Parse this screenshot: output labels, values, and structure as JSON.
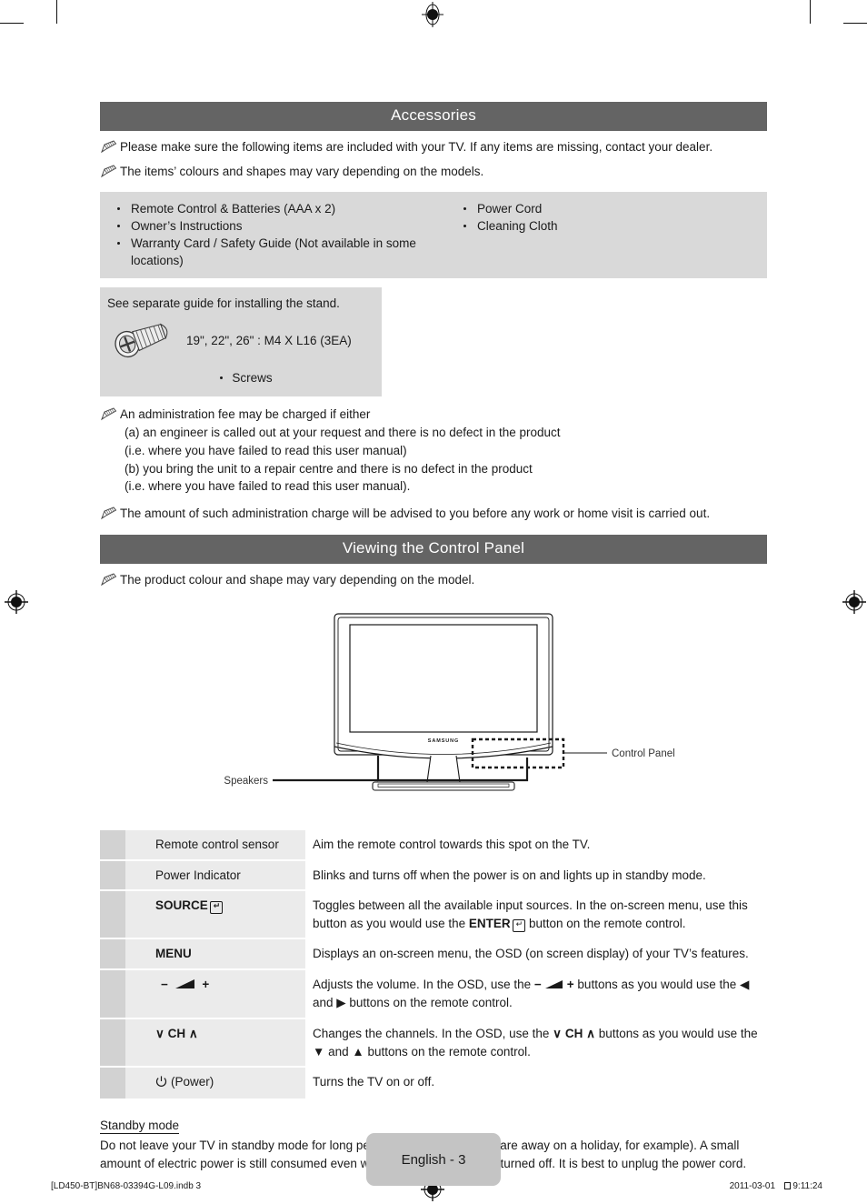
{
  "document": {
    "page_label": "English - 3",
    "footer_file": "[LD450-BT]BN68-03394G-L09.indb   3",
    "footer_page_num": "3",
    "footer_date": "2011-03-01",
    "footer_time": "9:11:24"
  },
  "accessories": {
    "heading": "Accessories",
    "notes": [
      "Please make sure the following items are included with your TV. If any items are missing, contact your dealer.",
      "The items’ colours and shapes may vary depending on the models."
    ],
    "items_left": [
      "Remote Control & Batteries (AAA x 2)",
      "Owner’s Instructions",
      "Warranty Card / Safety Guide (Not available in some locations)"
    ],
    "items_right": [
      "Power Cord",
      "Cleaning Cloth"
    ],
    "stand": {
      "title": "See separate guide for installing the stand.",
      "screw_spec": "19\", 22\", 26\" : M4 X L16 (3EA)",
      "screw_label": "Screws"
    },
    "admin_note_intro": "An administration fee may be charged if either",
    "admin_note_lines": [
      "(a) an engineer is called out at your request and there is no defect in the product",
      "(i.e. where you have failed to read this user manual)",
      "(b) you bring the unit to a repair centre and there is no defect in the product",
      "(i.e. where you have failed to read this user manual)."
    ],
    "admin_note_outro": "The amount of such administration charge will be advised to you before any work or home visit is carried out."
  },
  "control_panel": {
    "heading": "Viewing the Control Panel",
    "note": "The product colour and shape may vary depending on the model.",
    "figure": {
      "brand": "SAMSUNG",
      "callout_control_panel": "Control Panel",
      "callout_speakers": "Speakers"
    },
    "rows": [
      {
        "label": "Remote control sensor",
        "bold": false,
        "desc": "Aim the remote control towards this spot on the TV."
      },
      {
        "label": "Power Indicator",
        "bold": false,
        "desc": "Blinks and turns off when the power is on and lights up in standby mode."
      },
      {
        "label": "SOURCE",
        "bold": true,
        "has_enter_key": true,
        "desc_pre": "Toggles between all the available input sources. In the on-screen menu, use this button as you would use the ",
        "desc_mid": "ENTER",
        "desc_post": " button on the remote control."
      },
      {
        "label": "MENU",
        "bold": true,
        "desc": "Displays an on-screen menu, the OSD (on screen display) of your TV’s features."
      },
      {
        "label": "VOLUME",
        "bold": true,
        "is_volume": true,
        "desc_pre": "Adjusts the volume. In the OSD, use the ",
        "desc_post": " buttons as you would use the ◀ and ▶ buttons on the remote control."
      },
      {
        "label": "CH",
        "bold": true,
        "is_channel": true,
        "desc_pre": "Changes the channels. In the OSD, use the ",
        "desc_mid": "CH",
        "desc_post": " buttons as you would use the ▼ and ▲ buttons on the remote control."
      },
      {
        "label": "(Power)",
        "bold": false,
        "is_power": true,
        "desc": "Turns the TV on or off."
      }
    ],
    "standby": {
      "title": "Standby mode",
      "body": "Do not leave your TV in standby mode for long periods of time (when you are away on a holiday, for example). A small amount of electric power is still consumed even when the power button is turned off. It is best to unplug the power cord."
    }
  }
}
